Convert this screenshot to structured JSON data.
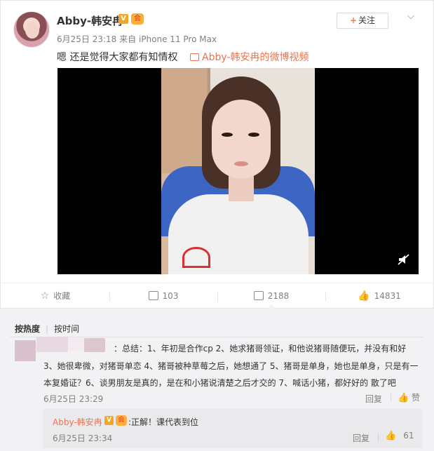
{
  "post": {
    "username": "Abby-韩安冉",
    "verified_badge": "V",
    "member_badge": "会",
    "time": "6月25日 23:18",
    "source_prefix": "来自",
    "source": "iPhone 11 Pro Max",
    "follow_label": "关注",
    "text": "嗯 还是觉得大家都有知情权",
    "video_link": "Abby-韩安冉的微博视频"
  },
  "actions": {
    "favorite_label": "收藏",
    "repost_count": "103",
    "comment_count": "2188",
    "like_count": "14831"
  },
  "comments": {
    "sort_hot": "按热度",
    "sort_time": "按时间",
    "items": [
      {
        "text": "：总结：1、年初是合作cp 2、她求猪哥领证，和他说猪哥随便玩，并没有和好 3、她很卑微，对猪哥单恋 4、猪哥被种草莓之后，她想通了 5、猪哥是单身，她也是单身，只是有一本复婚证？6、谈男朋友是真的，是在和小猪说清楚之后才交的 7、喊话小猪，都好好的 散了吧",
        "time": "6月25日 23:29",
        "reply_label": "回复",
        "like_label": "赞"
      }
    ],
    "reply": {
      "name": "Abby-韩安冉",
      "verified_badge": "V",
      "member_badge": "会",
      "text": ":正解！课代表到位",
      "time": "6月25日 23:34",
      "reply_label": "回复",
      "like_count": "61"
    }
  },
  "colors": {
    "accent": "#eb7350",
    "vip": "#f6a623",
    "comment_bg": "#f2f2f5"
  }
}
